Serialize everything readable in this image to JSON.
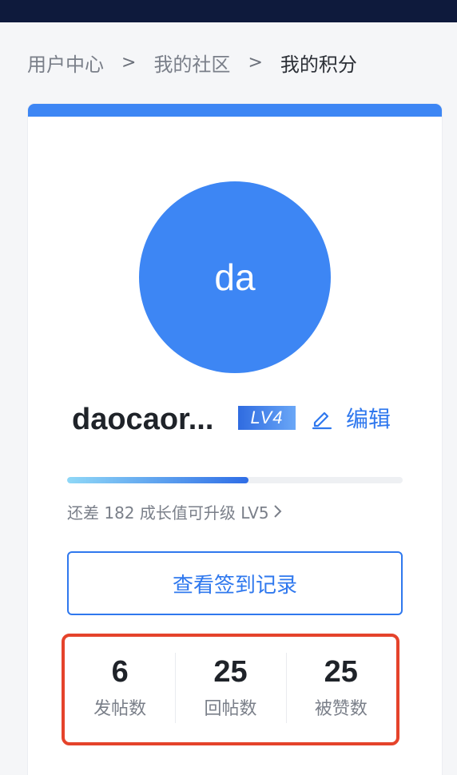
{
  "breadcrumb": {
    "items": [
      "用户中心",
      "我的社区",
      "我的积分"
    ],
    "separator": ">"
  },
  "profile": {
    "avatar_text": "da",
    "username": "daocaor...",
    "level": "LV4",
    "edit_label": "编辑",
    "growth_progress": 0.54,
    "upgrade_hint": "还差 182 成长值可升级 LV5"
  },
  "checkin": {
    "label": "查看签到记录"
  },
  "stats": [
    {
      "value": "6",
      "label": "发帖数"
    },
    {
      "value": "25",
      "label": "回帖数"
    },
    {
      "value": "25",
      "label": "被赞数"
    }
  ],
  "colors": {
    "accent": "#3d86f4",
    "highlight_border": "#e5432b",
    "header_bg": "#0e1a3c"
  }
}
